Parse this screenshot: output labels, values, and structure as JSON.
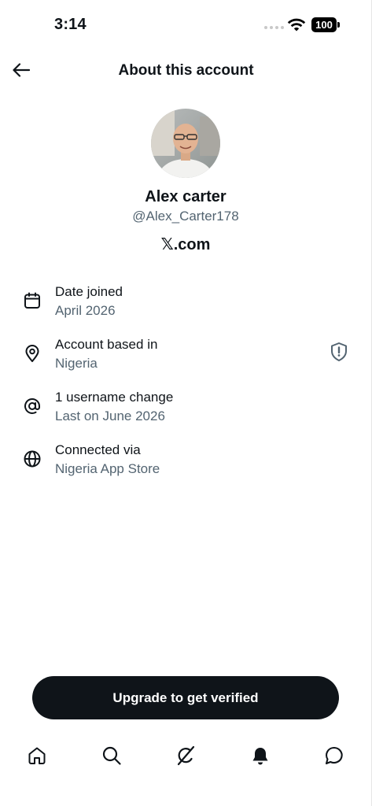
{
  "status_bar": {
    "time": "3:14",
    "battery": "100"
  },
  "header": {
    "title": "About this account"
  },
  "profile": {
    "name": "Alex carter",
    "handle": "@Alex_Carter178",
    "site": "𝕏.com"
  },
  "info": [
    {
      "icon": "calendar-icon",
      "title": "Date joined",
      "value": "April 2026"
    },
    {
      "icon": "location-pin-icon",
      "title": "Account based in",
      "value": "Nigeria"
    },
    {
      "icon": "at-sign-icon",
      "title": "1 username change",
      "value": "Last on June 2026"
    },
    {
      "icon": "globe-icon",
      "title": "Connected via",
      "value": "Nigeria App Store"
    }
  ],
  "upgrade": {
    "label": "Upgrade to get verified"
  },
  "tabs": [
    {
      "icon": "home-icon"
    },
    {
      "icon": "search-icon"
    },
    {
      "icon": "grok-icon"
    },
    {
      "icon": "bell-icon"
    },
    {
      "icon": "messages-icon"
    }
  ],
  "colors": {
    "text_primary": "#0f1419",
    "text_secondary": "#536471",
    "button_bg": "#0f1419"
  }
}
